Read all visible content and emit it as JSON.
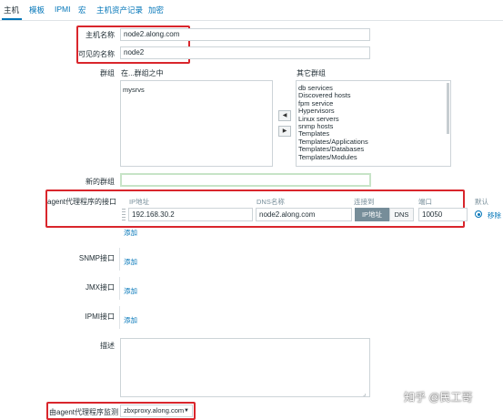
{
  "tabs": [
    "主机",
    "模板",
    "IPMI",
    "宏",
    "主机资产记录",
    "加密"
  ],
  "form": {
    "host_name_label": "主机名称",
    "host_name_value": "node2.along.com",
    "visible_name_label": "可见的名称",
    "visible_name_value": "node2",
    "groups_label": "群组",
    "in_groups_label": "在...群组之中",
    "other_groups_label": "其它群组",
    "in_groups": [
      "mysrvs"
    ],
    "other_groups": [
      "db services",
      "Discovered hosts",
      "fpm service",
      "Hypervisors",
      "Linux servers",
      "snmp hosts",
      "Templates",
      "Templates/Applications",
      "Templates/Databases",
      "Templates/Modules"
    ],
    "move_left": "◀",
    "move_right": "▶",
    "new_group_label": "新的群组",
    "new_group_value": "",
    "agent_interface_label": "agent代理程序的接口",
    "col_ip": "IP地址",
    "col_dns": "DNS名称",
    "col_connect": "连接到",
    "col_port": "端口",
    "col_default": "默认",
    "agent_ip": "192.168.30.2",
    "agent_dns": "node2.along.com",
    "connect_ip": "IP地址",
    "connect_dns": "DNS",
    "agent_port": "10050",
    "remove_label": "移除",
    "add_label": "添加",
    "snmp_label": "SNMP接口",
    "jmx_label": "JMX接口",
    "ipmi_label": "IPMI接口",
    "description_label": "描述",
    "description_value": "",
    "monitored_by_label": "由agent代理程序监测",
    "monitored_by_value": "zbxproxy.along.com",
    "dropdown_arrow": "▼"
  },
  "watermark": "知乎 @民工哥"
}
